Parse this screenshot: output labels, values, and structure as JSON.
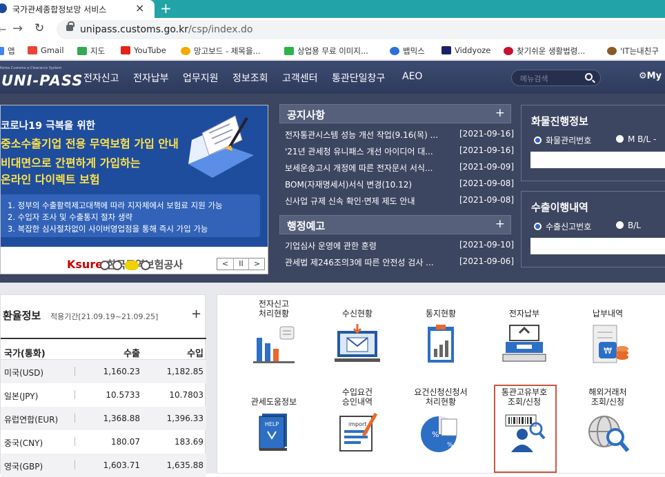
{
  "browser": {
    "tab_title": "국가관세종합정보망 서비스",
    "tab_close": "×",
    "new_tab": "+",
    "url_host": "unipass.customs.go.kr",
    "url_path": "/csp/index.do",
    "bookmarks": [
      "앱",
      "Gmail",
      "지도",
      "YouTube",
      "망고보드 - 제목을...",
      "상업용 무료 이미지...",
      "뱁믹스",
      "Viddyoze",
      "찾기쉬운 생활법령...",
      "'IT는내친구"
    ]
  },
  "header": {
    "logo_sub": "Korea Customs e-Clearance System",
    "logo": "UNI-PASS",
    "menu": [
      "전자신고",
      "전자납부",
      "업무지원",
      "정보조회",
      "고객센터",
      "통관단일창구",
      "AEO"
    ],
    "search_placeholder": "메뉴검색",
    "mypage": "My"
  },
  "banner": {
    "line1": "코로나19 극복을 위한",
    "line2": "중소수출기업 전용 무역보험 가입 안내",
    "line3": "비대면으로 간편하게 가입하는",
    "line4": "온라인 다이렉트 보험",
    "items": [
      "1. 정부의 수출활력제고대책에 따라 지자체에서 보험료 지원 가능",
      "2. 수입자 조사 및 수출통지 절차 생략",
      "3. 복잡한 심사절차없이 사이버영업점을 통해 즉시 가입 가능"
    ],
    "brand": "Ksure",
    "brand_kr": "한국무역보험공사",
    "ctrl": [
      "<",
      "II",
      ">"
    ]
  },
  "notice": {
    "title": "공지사항",
    "plus": "+",
    "rows": [
      {
        "t": "전자통관시스템 성능 개선 작업(9.16(목) ...",
        "d": "[2021-09-16]"
      },
      {
        "t": "'21년 관세청 유니패스 개선 아이디어 대...",
        "d": "[2021-09-16]"
      },
      {
        "t": "보세운송고시 개정에 따른 전자문서 서식...",
        "d": "[2021-09-09]"
      },
      {
        "t": "BOM(자재명세서)서식 변경(10.12)",
        "d": "[2021-09-08]"
      },
      {
        "t": "신사업 규제 신속 확인·면제 제도 안내",
        "d": "[2021-09-08]"
      }
    ]
  },
  "admin": {
    "title": "행정예고",
    "plus": "+",
    "rows": [
      {
        "t": "기업심사 운영에 관한 훈령",
        "d": "[2021-09-10]"
      },
      {
        "t": "관세법 제246조의3에 따른 안전성 검사 ...",
        "d": "[2021-09-06]"
      }
    ]
  },
  "cargo": {
    "title": "화물진행정보",
    "opt1": "화물관리번호",
    "opt2": "M B/L -"
  },
  "export": {
    "title": "수출이행내역",
    "opt1": "수출신고번호",
    "opt2": "B/L"
  },
  "rates": {
    "title": "환율정보",
    "period": "적용기간[21.09.19~21.09.25]",
    "plus": "+",
    "headers": [
      "국가(통화)",
      "수출",
      "수입"
    ],
    "rows": [
      [
        "미국(USD)",
        "1,160.23",
        "1,182.85"
      ],
      [
        "일본(JPY)",
        "10.5733",
        "10.7803"
      ],
      [
        "유럽연합(EUR)",
        "1,368.88",
        "1,396.33"
      ],
      [
        "중국(CNY)",
        "180.07",
        "183.69"
      ],
      [
        "영국(GBP)",
        "1,603.71",
        "1,635.88"
      ]
    ]
  },
  "services": {
    "row1": [
      {
        "l1": "전자신고",
        "l2": "처리현황"
      },
      {
        "l1": "수신현황",
        "l2": ""
      },
      {
        "l1": "통지현황",
        "l2": ""
      },
      {
        "l1": "전자납부",
        "l2": ""
      },
      {
        "l1": "납부내역",
        "l2": ""
      }
    ],
    "row2": [
      {
        "l1": "관세도움정보",
        "l2": ""
      },
      {
        "l1": "수입요건",
        "l2": "승인내역"
      },
      {
        "l1": "요건신청신청서",
        "l2": "처리현황"
      },
      {
        "l1": "통관고유부호",
        "l2": "조회/신청"
      },
      {
        "l1": "해외거래처",
        "l2": "조회/신청"
      }
    ],
    "help_text": "HELP",
    "import_text": "import"
  }
}
